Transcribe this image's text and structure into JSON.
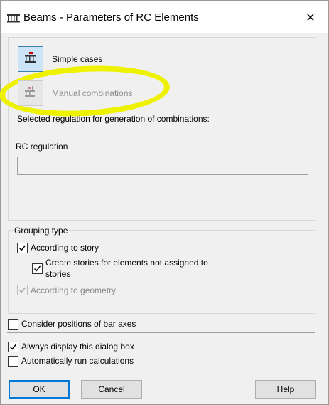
{
  "window": {
    "title": "Beams - Parameters of RC Elements",
    "close_glyph": "✕"
  },
  "cases": {
    "simple_label": "Simple cases",
    "manual_label": "Manual combinations",
    "regulation_caption": "Selected regulation for generation of combinations:"
  },
  "regulation": {
    "label": "RC regulation",
    "value": ""
  },
  "grouping": {
    "title": "Grouping type",
    "according_story": {
      "label": "According to story",
      "checked": true
    },
    "create_stories": {
      "label_line1": "Create stories for elements not assigned to",
      "label_line2": "stories",
      "checked": true
    },
    "according_geometry": {
      "label": "According to geometry",
      "checked": true,
      "enabled": false
    }
  },
  "options": {
    "bar_axes": {
      "label": "Consider positions of bar axes",
      "checked": false
    },
    "always_display": {
      "label": "Always display this dialog box",
      "checked": true
    },
    "auto_run": {
      "label": "Automatically run calculations",
      "checked": false
    }
  },
  "buttons": {
    "ok": "OK",
    "cancel": "Cancel",
    "help": "Help"
  },
  "colors": {
    "annotation_highlight": "#eef200",
    "selected_button_fill": "#cce4f7",
    "default_button_border": "#0078d7"
  },
  "icons": [
    "beam-app-icon",
    "close-icon",
    "simple-cases-icon",
    "manual-combinations-icon",
    "check-icon"
  ]
}
